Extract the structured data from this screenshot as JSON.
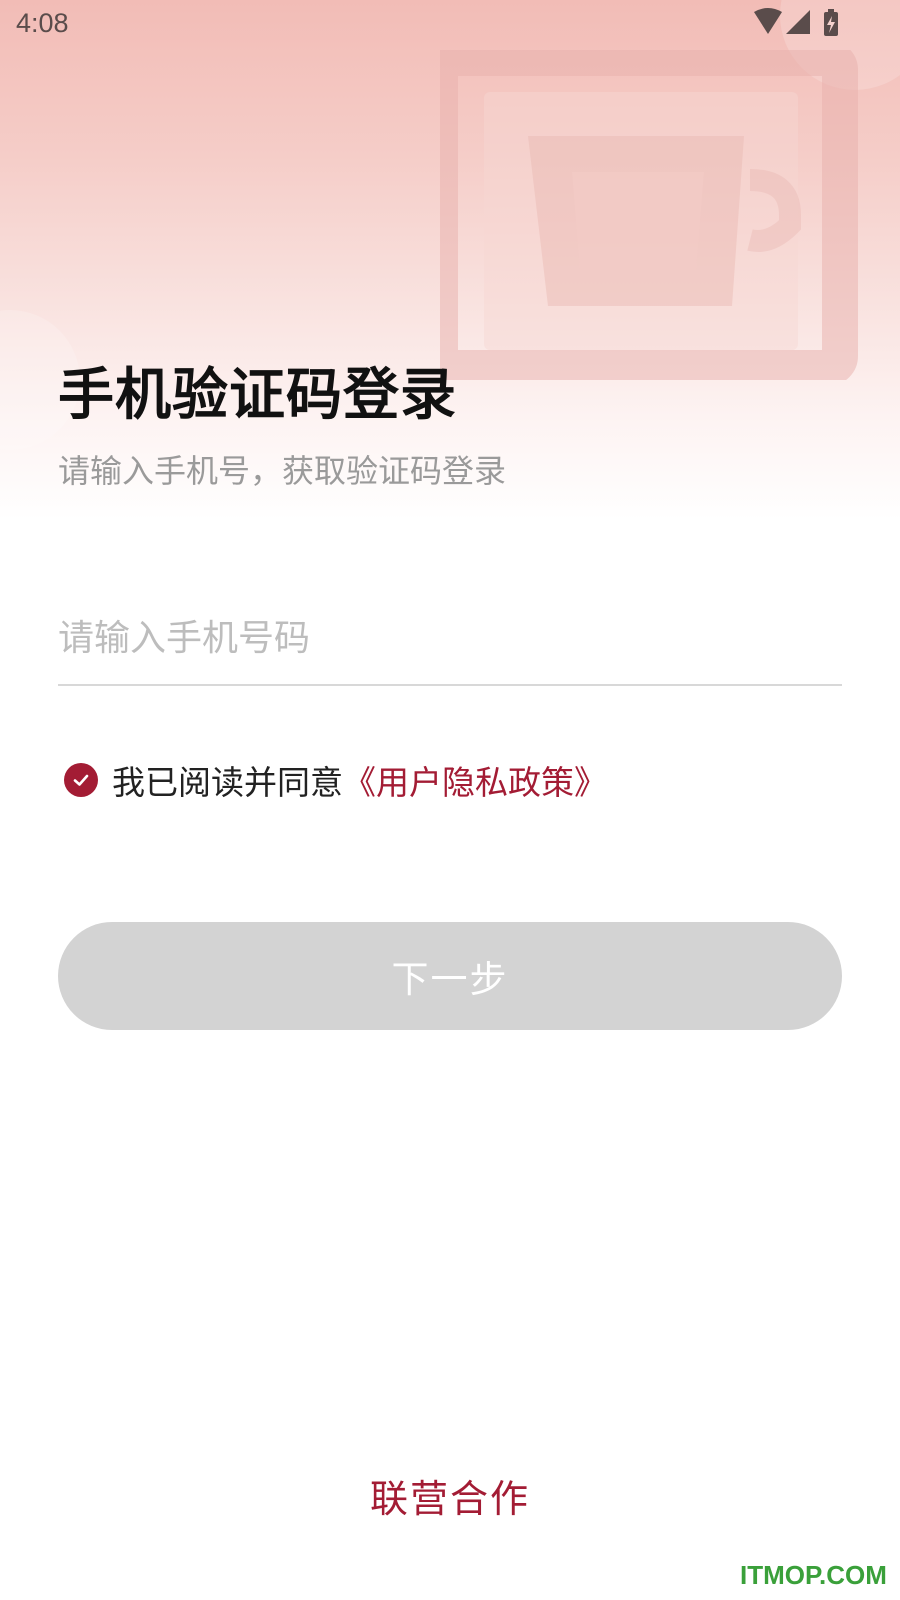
{
  "status_bar": {
    "time": "4:08",
    "icons": [
      "wifi-icon",
      "cell-signal-icon",
      "battery-charging-icon"
    ]
  },
  "login": {
    "title": "手机验证码登录",
    "subtitle": "请输入手机号，获取验证码登录",
    "phone_placeholder": "请输入手机号码",
    "phone_value": "",
    "agreement_checked": true,
    "agreement_text": "我已阅读并同意",
    "policy_link": "《用户隐私政策》",
    "next_button": "下一步",
    "next_button_enabled": false
  },
  "footer": {
    "partner_link": "联营合作",
    "watermark": "ITMOP.COM"
  },
  "colors": {
    "brand": "#a31c34",
    "button_disabled": "#d3d3d3",
    "hero_gradient_top": "#f2bcb6",
    "watermark_green": "#3aa03a"
  }
}
